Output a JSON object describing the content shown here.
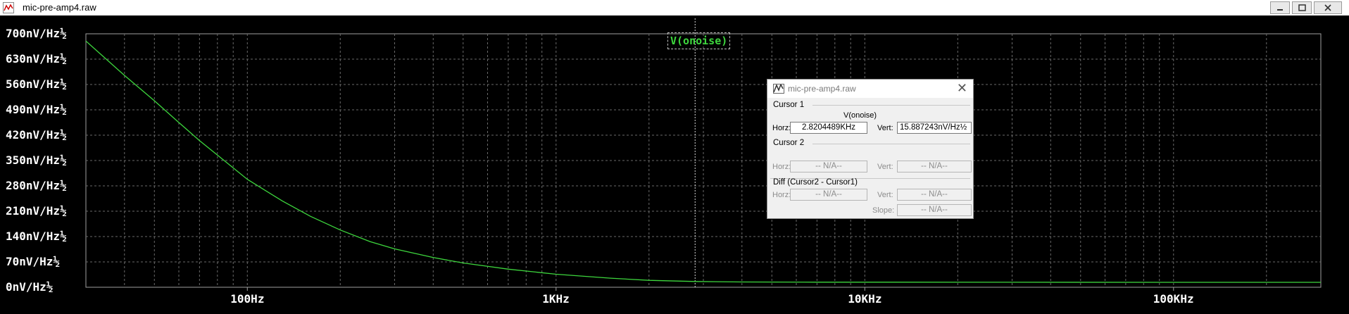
{
  "window": {
    "title": "mic-pre-amp4.raw"
  },
  "trace": {
    "name": "V(onoise)",
    "color": "#3dd63d"
  },
  "y_ticks": [
    "700nV/Hz½",
    "630nV/Hz½",
    "560nV/Hz½",
    "490nV/Hz½",
    "420nV/Hz½",
    "350nV/Hz½",
    "280nV/Hz½",
    "210nV/Hz½",
    "140nV/Hz½",
    "70nV/Hz½",
    "0nV/Hz½"
  ],
  "x_ticks": [
    "100Hz",
    "1KHz",
    "10KHz",
    "100KHz"
  ],
  "chart_data": {
    "type": "line",
    "xscale": "log",
    "xlim": [
      30,
      300000
    ],
    "ylim": [
      0,
      700
    ],
    "yunit": "nV/Hz½",
    "grid": true,
    "series": [
      {
        "name": "V(onoise)",
        "x": [
          30,
          40,
          50,
          60,
          70,
          80,
          100,
          130,
          160,
          200,
          250,
          300,
          400,
          500,
          700,
          1000,
          1500,
          2000,
          2820,
          4000,
          7000,
          10000,
          30000,
          100000,
          300000
        ],
        "y": [
          680,
          585,
          515,
          455,
          405,
          365,
          298,
          238,
          196,
          158,
          126,
          106,
          82,
          67,
          50,
          36,
          25,
          19,
          15.9,
          14.5,
          14,
          14,
          13.8,
          13.7,
          13.7
        ]
      }
    ],
    "cursor_x": 2820.4489
  },
  "cursor_dialog": {
    "title": "mic-pre-amp4.raw",
    "cursor1": {
      "label": "Cursor 1",
      "trace": "V(onoise)",
      "horz_label": "Horz:",
      "horz": "2.8204489KHz",
      "vert_label": "Vert:",
      "vert": "15.887243nV/Hz½"
    },
    "cursor2": {
      "label": "Cursor 2",
      "horz_label": "Horz:",
      "horz": "-- N/A--",
      "vert_label": "Vert:",
      "vert": "-- N/A--"
    },
    "diff": {
      "label": "Diff (Cursor2 - Cursor1)",
      "horz_label": "Horz:",
      "horz": "-- N/A--",
      "vert_label": "Vert:",
      "vert": "-- N/A--",
      "slope_label": "Slope:",
      "slope": "-- N/A--"
    }
  }
}
